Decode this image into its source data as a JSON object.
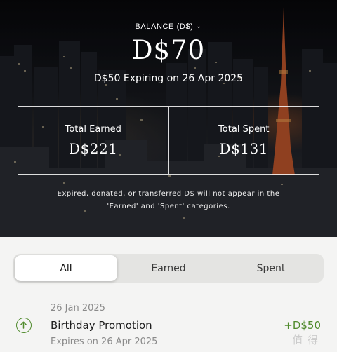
{
  "balance": {
    "label": "BALANCE (D$)",
    "amount": "D$70",
    "expiring_note": "D$50 Expiring on 26 Apr 2025"
  },
  "stats": {
    "earned_label": "Total Earned",
    "earned_value": "D$221",
    "spent_label": "Total Spent",
    "spent_value": "D$131"
  },
  "note": {
    "line1": "Expired, donated, or transferred D$ will not appear in the",
    "line2": "'Earned' and 'Spent' categories."
  },
  "tabs": [
    {
      "label": "All",
      "active": true
    },
    {
      "label": "Earned",
      "active": false
    },
    {
      "label": "Spent",
      "active": false
    }
  ],
  "transactions": [
    {
      "date": "26 Jan 2025",
      "title": "Birthday Promotion",
      "amount": "+D$50",
      "expires": "Expires on 26 Apr 2025",
      "icon": "arrow-up-circle-icon"
    }
  ],
  "watermark": "值 得",
  "colors": {
    "positive": "#4f8a2c",
    "tab_track": "#e4e4e2",
    "tab_active": "#ffffff"
  }
}
